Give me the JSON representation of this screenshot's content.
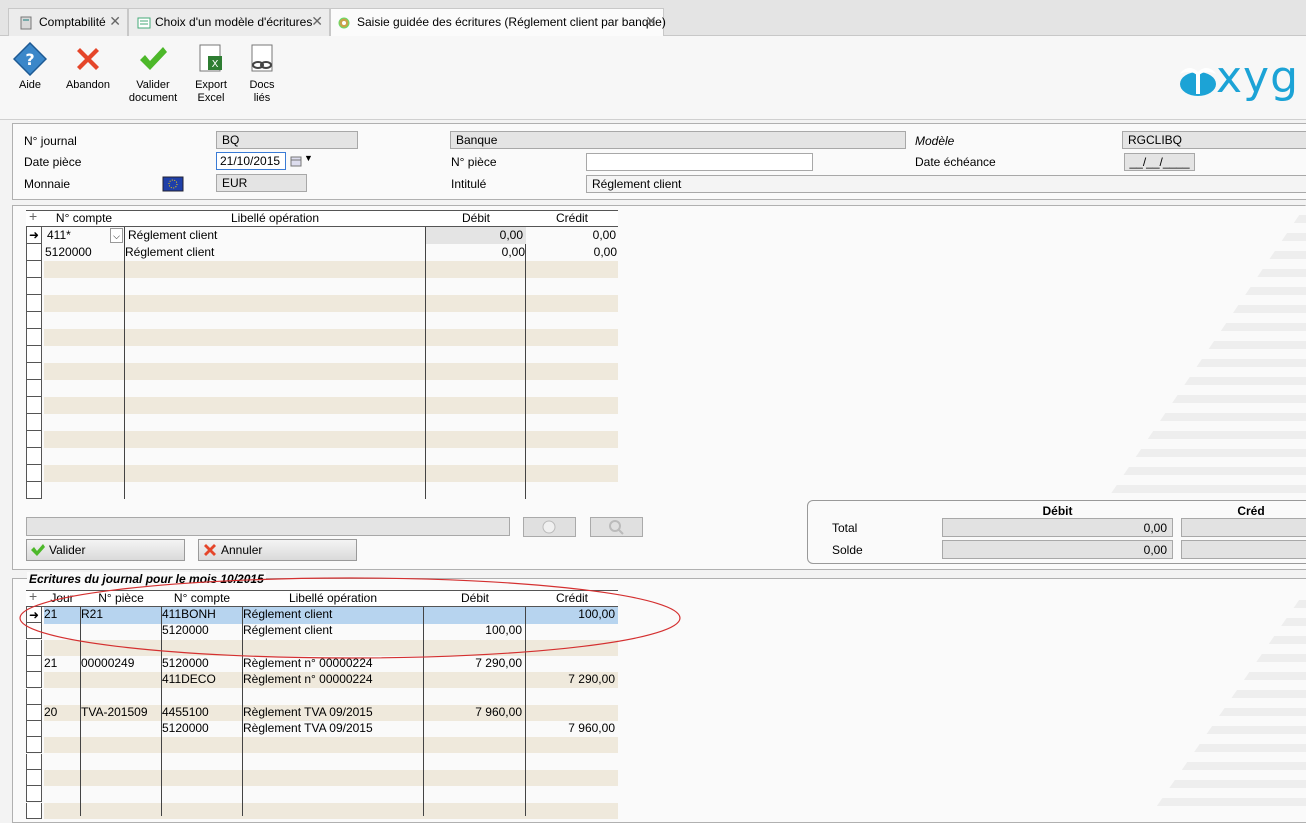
{
  "tabs": [
    {
      "label": "Comptabilité"
    },
    {
      "label": "Choix d'un modèle d'écritures"
    },
    {
      "label": "Saisie guidée des écritures (Réglement client par banque)"
    }
  ],
  "toolbar": {
    "aide": "Aide",
    "abandon": "Abandon",
    "valider_l1": "Valider",
    "valider_l2": "document",
    "export_l1": "Export",
    "export_l2": "Excel",
    "docs_l1": "Docs",
    "docs_l2": "liés"
  },
  "brand": {
    "logo_text": "xyg"
  },
  "header": {
    "journal_label": "N° journal",
    "journal_value": "BQ",
    "journal_name": "Banque",
    "modele_label": "Modèle",
    "modele_value": "RGCLIBQ",
    "date_label": "Date pièce",
    "date_value": "21/10/2015",
    "piece_label": "N° pièce",
    "piece_value": "",
    "echeance_label": "Date échéance",
    "echeance_value": "__/__/____",
    "monnaie_label": "Monnaie",
    "monnaie_value": "EUR",
    "intitule_label": "Intitulé",
    "intitule_value": "Réglement client"
  },
  "entry_grid": {
    "headers": {
      "compte": "N° compte",
      "libelle": "Libellé opération",
      "debit": "Débit",
      "credit": "Crédit"
    },
    "rows": [
      {
        "compte": "411*",
        "libelle": "Réglement client",
        "debit": "0,00",
        "credit": "0,00"
      },
      {
        "compte": "5120000",
        "libelle": "Réglement client",
        "debit": "0,00",
        "credit": "0,00"
      }
    ]
  },
  "actions": {
    "valider": "Valider",
    "annuler": "Annuler"
  },
  "totals": {
    "debit_header": "Débit",
    "credit_header": "Créd",
    "total_label": "Total",
    "total_debit": "0,00",
    "solde_label": "Solde",
    "solde_debit": "0,00"
  },
  "journal": {
    "title": "Ecritures du journal pour le mois 10/2015",
    "headers": {
      "jour": "Jour",
      "piece": "N° pièce",
      "compte": "N° compte",
      "libelle": "Libellé opération",
      "debit": "Débit",
      "credit": "Crédit"
    },
    "rows": [
      {
        "jour": "21",
        "piece": "R21",
        "compte": "411BONH",
        "libelle": "Réglement client",
        "debit": "",
        "credit": "100,00"
      },
      {
        "jour": "",
        "piece": "",
        "compte": "5120000",
        "libelle": "Réglement client",
        "debit": "100,00",
        "credit": ""
      },
      {
        "jour": "",
        "piece": "",
        "compte": "",
        "libelle": "",
        "debit": "",
        "credit": ""
      },
      {
        "jour": "21",
        "piece": "00000249",
        "compte": "5120000",
        "libelle": "Règlement n° 00000224",
        "debit": "7 290,00",
        "credit": ""
      },
      {
        "jour": "",
        "piece": "",
        "compte": "411DECO",
        "libelle": "Règlement n° 00000224",
        "debit": "",
        "credit": "7 290,00"
      },
      {
        "jour": "",
        "piece": "",
        "compte": "",
        "libelle": "",
        "debit": "",
        "credit": ""
      },
      {
        "jour": "20",
        "piece": "TVA-201509",
        "compte": "4455100",
        "libelle": "Règlement TVA 09/2015",
        "debit": "7 960,00",
        "credit": ""
      },
      {
        "jour": "",
        "piece": "",
        "compte": "5120000",
        "libelle": "Règlement TVA 09/2015",
        "debit": "",
        "credit": "7 960,00"
      }
    ]
  }
}
